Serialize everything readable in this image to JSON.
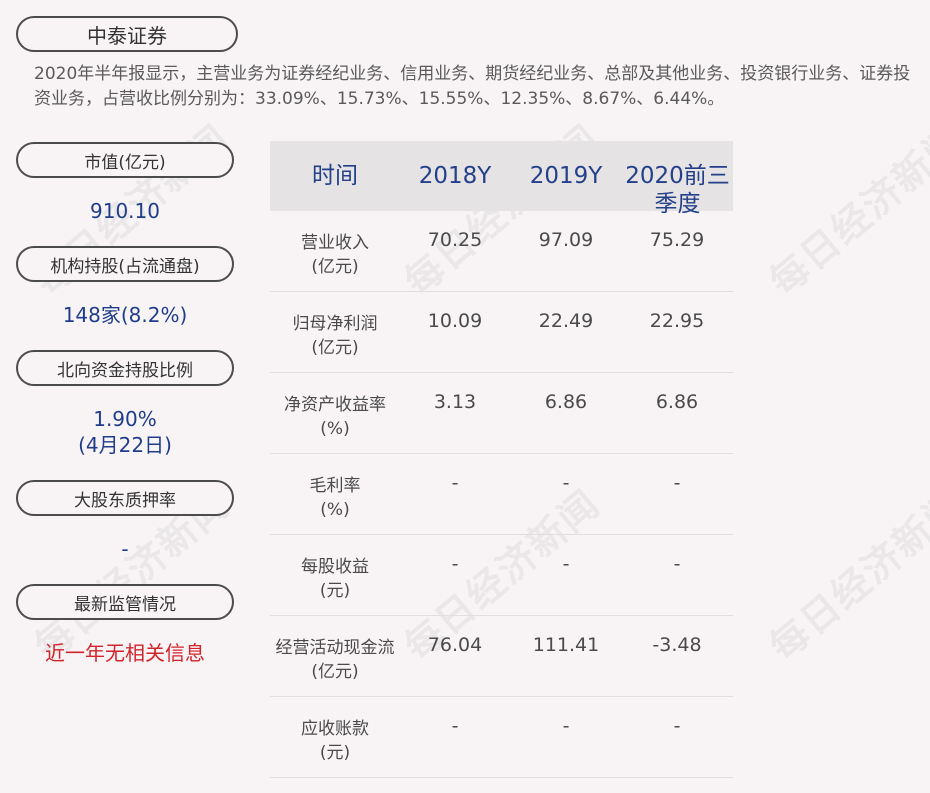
{
  "company": {
    "name": "中泰证券"
  },
  "summary": "2020年半年报显示，主营业务为证券经纪业务、信用业务、期货经纪业务、总部及其他业务、投资银行业务、证券投资业务，占营收比例分别为：33.09%、15.73%、15.55%、12.35%、8.67%、6.44%。",
  "sidebar": {
    "items": [
      {
        "label": "市值(亿元)",
        "value": "910.10"
      },
      {
        "label": "机构持股(占流通盘)",
        "value": "148家(8.2%)"
      },
      {
        "label": "北向资金持股比例",
        "value": "1.90%",
        "value2": "(4月22日)"
      },
      {
        "label": "大股东质押率",
        "value": "-"
      },
      {
        "label": "最新监管情况",
        "value": "近一年无相关信息"
      }
    ]
  },
  "table": {
    "headers": [
      "时间",
      "2018Y",
      "2019Y",
      "2020前三",
      "季度"
    ],
    "rows": [
      {
        "label1": "营业收入",
        "label2": "(亿元)",
        "values": [
          "70.25",
          "97.09",
          "75.29"
        ]
      },
      {
        "label1": "归母净利润",
        "label2": "(亿元)",
        "values": [
          "10.09",
          "22.49",
          "22.95"
        ]
      },
      {
        "label1": "净资产收益率",
        "label2": "(%)",
        "values": [
          "3.13",
          "6.86",
          "6.86"
        ]
      },
      {
        "label1": "毛利率",
        "label2": "(%)",
        "values": [
          "-",
          "-",
          "-"
        ]
      },
      {
        "label1": "每股收益",
        "label2": "(元)",
        "values": [
          "-",
          "-",
          "-"
        ]
      },
      {
        "label1": "经营活动现金流",
        "label2": "(亿元)",
        "values": [
          "76.04",
          "111.41",
          "-3.48"
        ]
      },
      {
        "label1": "应收账款",
        "label2": "(元)",
        "values": [
          "-",
          "-",
          "-"
        ]
      }
    ]
  },
  "watermark": {
    "text": "每日经济新闻"
  },
  "colors": {
    "background": "#f8f4f5",
    "accent_blue": "#24408a",
    "alert_red": "#d1242b",
    "header_bg": "#e5e3e4"
  }
}
